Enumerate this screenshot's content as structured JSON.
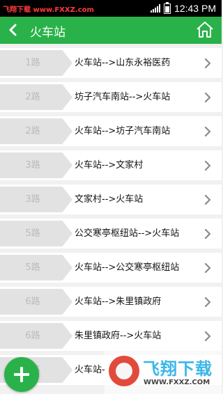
{
  "status_bar": {
    "watermark_text": "飞翔下载 www.FXXZ.com",
    "time": "12:43 PM"
  },
  "header": {
    "title": "火车站",
    "back_icon": "chevron-left-icon",
    "home_icon": "home-icon",
    "background": "#2ab24a"
  },
  "routes": [
    {
      "number": "1路",
      "name": "火车站-->山东永裕医药"
    },
    {
      "number": "2路",
      "name": "坊子汽车南站-->火车站"
    },
    {
      "number": "2路",
      "name": "火车站-->坊子汽车南站"
    },
    {
      "number": "3路",
      "name": "火车站-->文家村"
    },
    {
      "number": "3路",
      "name": "文家村-->火车站"
    },
    {
      "number": "5路",
      "name": "公交寒亭枢纽站-->火车站"
    },
    {
      "number": "5路",
      "name": "火车站-->公交寒亭枢纽站"
    },
    {
      "number": "6路",
      "name": "火车站-->朱里镇政府"
    },
    {
      "number": "6路",
      "name": "朱里镇政府-->火车站"
    },
    {
      "number": "8路",
      "name": "火车站-"
    }
  ],
  "fab": {
    "icon": "plus-icon",
    "color": "#2ab24a"
  },
  "watermark": {
    "name": "飞翔下载",
    "url": "WWW.FXXZ.COM"
  }
}
